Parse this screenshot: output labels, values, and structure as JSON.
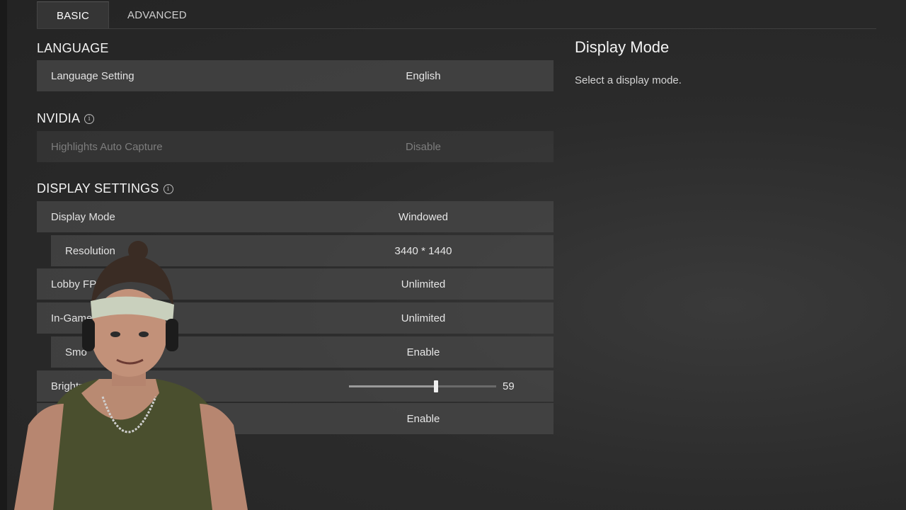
{
  "tabs": [
    {
      "label": "BASIC",
      "active": true
    },
    {
      "label": "ADVANCED",
      "active": false
    }
  ],
  "sections": {
    "language": {
      "title": "LANGUAGE"
    },
    "nvidia": {
      "title": "NVIDIA",
      "info_icon": "info-icon"
    },
    "display": {
      "title": "DISPLAY SETTINGS",
      "info_icon": "info-icon"
    }
  },
  "rows": {
    "language_setting": {
      "label": "Language Setting",
      "value": "English"
    },
    "highlights": {
      "label": "Highlights Auto Capture",
      "value": "Disable"
    },
    "display_mode": {
      "label": "Display Mode",
      "value": "Windowed"
    },
    "resolution": {
      "label": "Resolution",
      "value": "3440 * 1440"
    },
    "lobby_fps": {
      "label": "Lobby FPS",
      "value": "Unlimited"
    },
    "ingame_fps": {
      "label": "In-Game",
      "value": "Unlimited"
    },
    "smoothing": {
      "label": "Smo",
      "value": "Enable"
    },
    "brightness": {
      "label": "Brightness",
      "value": "59",
      "level_percent": 59
    },
    "last_row": {
      "label": "",
      "value": "Enable"
    }
  },
  "description": {
    "title": "Display Mode",
    "text": "Select a display mode."
  },
  "colors": {
    "background": "#2b2b2b",
    "row": "#464646",
    "text": "#e2e2e2"
  }
}
